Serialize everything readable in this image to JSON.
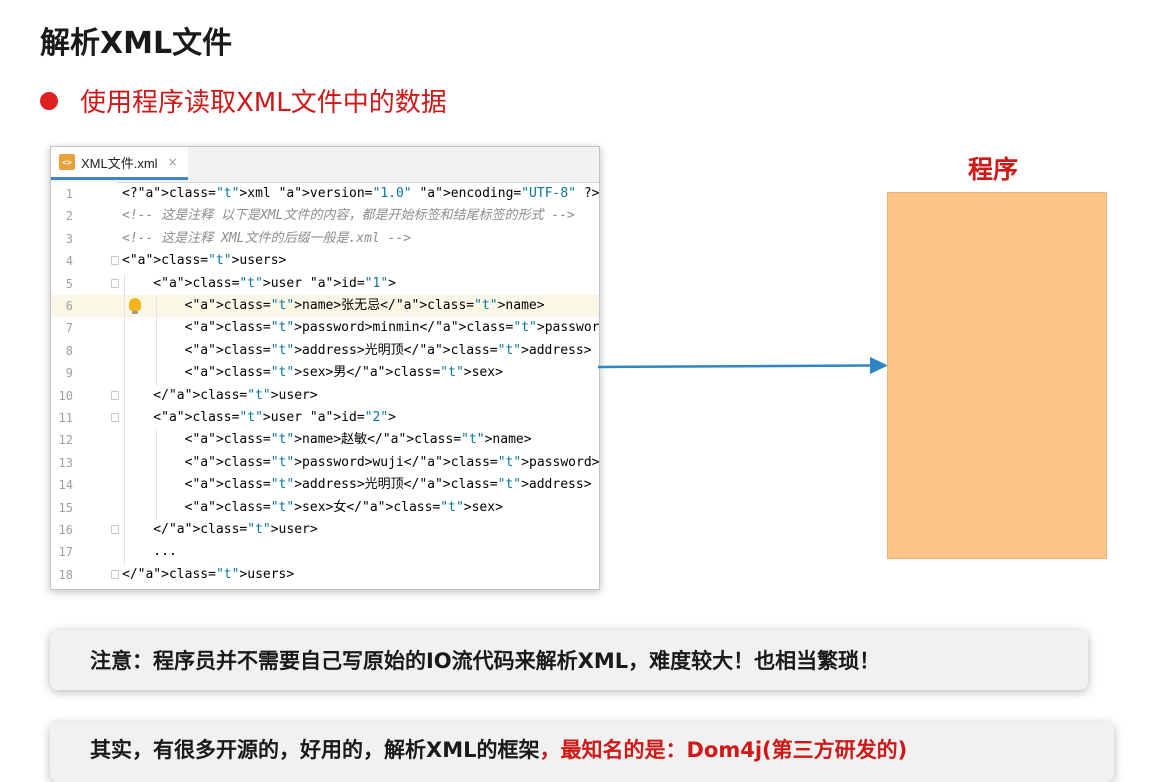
{
  "page": {
    "title": "解析XML文件",
    "bullet": "使用程序读取XML文件中的数据"
  },
  "editor": {
    "tab_label": "XML文件.xml",
    "tab_close": "×",
    "file_icon": "xml-file-icon",
    "lines": [
      {
        "n": "1",
        "code": "<?xml version=\"1.0\" encoding=\"UTF-8\" ?>"
      },
      {
        "n": "2",
        "code": "<!-- 这是注释 以下是XML文件的内容，都是开始标签和结尾标签的形式 -->"
      },
      {
        "n": "3",
        "code": "<!-- 这是注释 XML文件的后缀一般是.xml -->"
      },
      {
        "n": "4",
        "code": "<users>"
      },
      {
        "n": "5",
        "code": "    <user id=\"1\">"
      },
      {
        "n": "6",
        "code": "        <name>张无忌</name>"
      },
      {
        "n": "7",
        "code": "        <password>minmin</password>"
      },
      {
        "n": "8",
        "code": "        <address>光明顶</address>"
      },
      {
        "n": "9",
        "code": "        <sex>男</sex>"
      },
      {
        "n": "10",
        "code": "    </user>"
      },
      {
        "n": "11",
        "code": "    <user id=\"2\">"
      },
      {
        "n": "12",
        "code": "        <name>赵敏</name>"
      },
      {
        "n": "13",
        "code": "        <password>wuji</password>"
      },
      {
        "n": "14",
        "code": "        <address>光明顶</address>"
      },
      {
        "n": "15",
        "code": "        <sex>女</sex>"
      },
      {
        "n": "16",
        "code": "    </user>"
      },
      {
        "n": "17",
        "code": "    ..."
      },
      {
        "n": "18",
        "code": "</users>"
      }
    ]
  },
  "diagram": {
    "program_label": "程序",
    "arrow_color": "#2f86c4",
    "box_color": "#fcc58a"
  },
  "notes": {
    "note1": "注意：程序员并不需要自己写原始的IO流代码来解析XML，难度较大！也相当繁琐！",
    "note2_prefix": "其实，有很多开源的，好用的，解析XML的框架",
    "note2_highlight": "，最知名的是：Dom4j(第三方研发的)"
  },
  "colors": {
    "accent_red": "#d01818",
    "tab_underline": "#4083c9"
  }
}
